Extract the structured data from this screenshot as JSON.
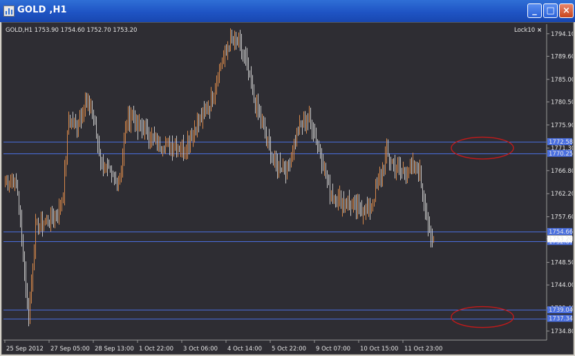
{
  "window": {
    "title": "GOLD ,H1",
    "buttons": {
      "minimize": "_",
      "maximize": "□",
      "close": "×"
    }
  },
  "chart_header": {
    "info": "GOLD,H1  1753.90 1754.60 1752.70 1753.20",
    "lock_label": "Lock10",
    "lock_close": "×"
  },
  "colors": {
    "background": "#2e2d33",
    "bull": "#d9894a",
    "bear": "#c8c8c8",
    "hline": "#4a6fe0",
    "ellipse": "#c41a1a"
  },
  "chart_data": {
    "type": "candlestick",
    "symbol": "GOLD",
    "timeframe": "H1",
    "ylim": [
      1733.0,
      1796.0
    ],
    "y_ticks": [
      1794.1,
      1789.6,
      1785.0,
      1780.5,
      1775.9,
      1771.3,
      1766.8,
      1762.2,
      1757.6,
      1753.2,
      1748.5,
      1744.0,
      1739.4,
      1734.8
    ],
    "x_labels": [
      "25 Sep 2012",
      "27 Sep 05:00",
      "28 Sep 13:00",
      "1 Oct 22:00",
      "3 Oct 06:00",
      "4 Oct 14:00",
      "5 Oct 22:00",
      "9 Oct 07:00",
      "10 Oct 15:00",
      "11 Oct 23:00"
    ],
    "x_label_bars": [
      0,
      32,
      64,
      96,
      128,
      160,
      192,
      224,
      256,
      288
    ],
    "price_levels": [
      {
        "label": "1772.58",
        "value": 1772.58
      },
      {
        "label": "1770.25",
        "value": 1770.25
      },
      {
        "label": "1754.66",
        "value": 1754.66
      },
      {
        "label": "1752.67",
        "value": 1752.67
      },
      {
        "label": "1739.04",
        "value": 1739.04
      },
      {
        "label": "1737.34",
        "value": 1737.34
      }
    ],
    "current_price": {
      "label": "1753.20",
      "value": 1753.2
    },
    "ellipse_levels": [
      {
        "top": 1773.2,
        "bottom": 1769.4
      },
      {
        "top": 1739.4,
        "bottom": 1735.8
      }
    ],
    "key_points": [
      [
        0,
        1764.5
      ],
      [
        6,
        1765.0
      ],
      [
        9,
        1762.5
      ],
      [
        17,
        1737.5
      ],
      [
        22,
        1755.5
      ],
      [
        30,
        1757.0
      ],
      [
        38,
        1758.0
      ],
      [
        42,
        1762.5
      ],
      [
        46,
        1777.0
      ],
      [
        52,
        1776.0
      ],
      [
        58,
        1780.0
      ],
      [
        62,
        1780.0
      ],
      [
        70,
        1768.0
      ],
      [
        80,
        1764.5
      ],
      [
        84,
        1767.0
      ],
      [
        88,
        1777.0
      ],
      [
        92,
        1778.0
      ],
      [
        96,
        1775.0
      ],
      [
        100,
        1775.5
      ],
      [
        104,
        1774.0
      ],
      [
        110,
        1772.0
      ],
      [
        120,
        1772.0
      ],
      [
        130,
        1771.5
      ],
      [
        140,
        1776.5
      ],
      [
        148,
        1780.0
      ],
      [
        156,
        1788.0
      ],
      [
        162,
        1792.0
      ],
      [
        168,
        1792.5
      ],
      [
        174,
        1789.0
      ],
      [
        180,
        1781.0
      ],
      [
        188,
        1774.0
      ],
      [
        194,
        1768.5
      ],
      [
        204,
        1767.0
      ],
      [
        212,
        1775.0
      ],
      [
        218,
        1777.5
      ],
      [
        222,
        1776.0
      ],
      [
        228,
        1770.5
      ],
      [
        234,
        1763.5
      ],
      [
        240,
        1761.0
      ],
      [
        248,
        1760.5
      ],
      [
        256,
        1759.0
      ],
      [
        264,
        1759.5
      ],
      [
        270,
        1764.0
      ],
      [
        276,
        1770.0
      ],
      [
        284,
        1767.0
      ],
      [
        290,
        1766.5
      ],
      [
        296,
        1767.5
      ],
      [
        300,
        1766.0
      ],
      [
        304,
        1759.5
      ],
      [
        308,
        1752.5
      ],
      [
        310,
        1753.2
      ]
    ]
  }
}
